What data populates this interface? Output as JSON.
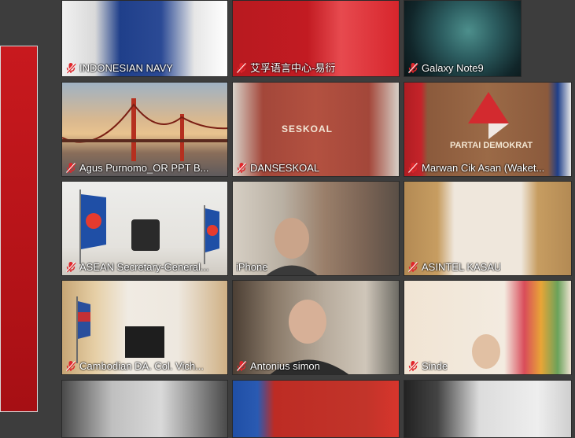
{
  "app": {
    "type": "video-conference-gallery"
  },
  "participants": [
    {
      "name": "INDONESIAN NAVY",
      "muted": true,
      "icon": "mic-muted-icon"
    },
    {
      "name": "艾孚语言中心-易衍",
      "muted": true,
      "icon": "mic-muted-icon"
    },
    {
      "name": "Galaxy Note9",
      "muted": true,
      "icon": "mic-muted-icon"
    },
    {
      "name": "Agus Purnomo_OR PPT B...",
      "muted": true,
      "icon": "mic-muted-icon"
    },
    {
      "name": "DANSESKOAL",
      "muted": true,
      "icon": "mic-muted-icon"
    },
    {
      "name": "Marwan Cik Asan (Waket...",
      "muted": true,
      "icon": "mic-muted-icon"
    },
    {
      "name": "ASEAN Secretary-General...",
      "muted": true,
      "icon": "mic-muted-icon"
    },
    {
      "name": "iPhone",
      "muted": false,
      "icon": ""
    },
    {
      "name": "ASINTEL KASAU",
      "muted": true,
      "icon": "mic-muted-icon"
    },
    {
      "name": "Cambodian DA. Col. Vich...",
      "muted": true,
      "icon": "mic-muted-icon"
    },
    {
      "name": "Antonius simon",
      "muted": true,
      "icon": "mic-muted-icon"
    },
    {
      "name": "Sinde",
      "muted": true,
      "icon": "mic-muted-icon"
    }
  ],
  "backdrop_text": {
    "seskoal_sign": "SESKOAL",
    "party_sign": "PARTAI DEMOKRAT"
  },
  "colors": {
    "mic_muted_red": "#e0262b",
    "gallery_bg": "#3d3d3d"
  }
}
